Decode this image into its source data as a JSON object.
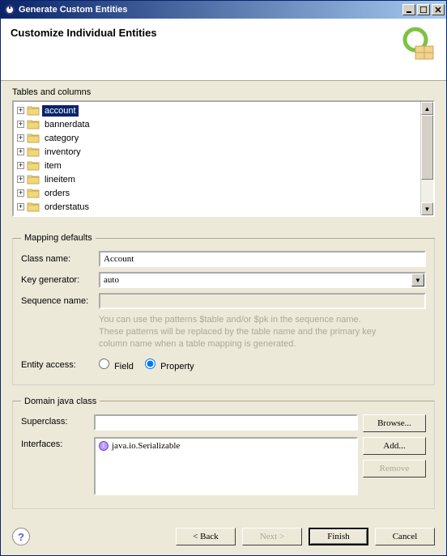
{
  "window": {
    "title": "Generate Custom Entities",
    "icon": "eclipse-icon"
  },
  "banner": {
    "title": "Customize Individual Entities"
  },
  "tables": {
    "label": "Tables and columns",
    "items": [
      {
        "label": "account",
        "selected": true
      },
      {
        "label": "bannerdata"
      },
      {
        "label": "category"
      },
      {
        "label": "inventory"
      },
      {
        "label": "item"
      },
      {
        "label": "lineitem"
      },
      {
        "label": "orders"
      },
      {
        "label": "orderstatus"
      }
    ]
  },
  "mapping": {
    "legend": "Mapping defaults",
    "class_name_label": "Class name:",
    "class_name_value": "Account",
    "key_gen_label": "Key generator:",
    "key_gen_value": "auto",
    "seq_name_label": "Sequence name:",
    "seq_name_value": "",
    "hint_line1": "You can use the patterns $table and/or $pk in the sequence name.",
    "hint_line2": "These patterns will be replaced by the table name and the primary key",
    "hint_line3": "column name when a table mapping is generated.",
    "entity_access_label": "Entity access:",
    "radio_field": "Field",
    "radio_property": "Property",
    "radio_selected": "property"
  },
  "domain": {
    "legend": "Domain java class",
    "superclass_label": "Superclass:",
    "superclass_value": "",
    "interfaces_label": "Interfaces:",
    "interfaces": [
      "java.io.Serializable"
    ],
    "browse_btn": "Browse...",
    "add_btn": "Add...",
    "remove_btn": "Remove"
  },
  "buttons": {
    "help": "?",
    "back": "< Back",
    "next": "Next >",
    "finish": "Finish",
    "cancel": "Cancel"
  }
}
